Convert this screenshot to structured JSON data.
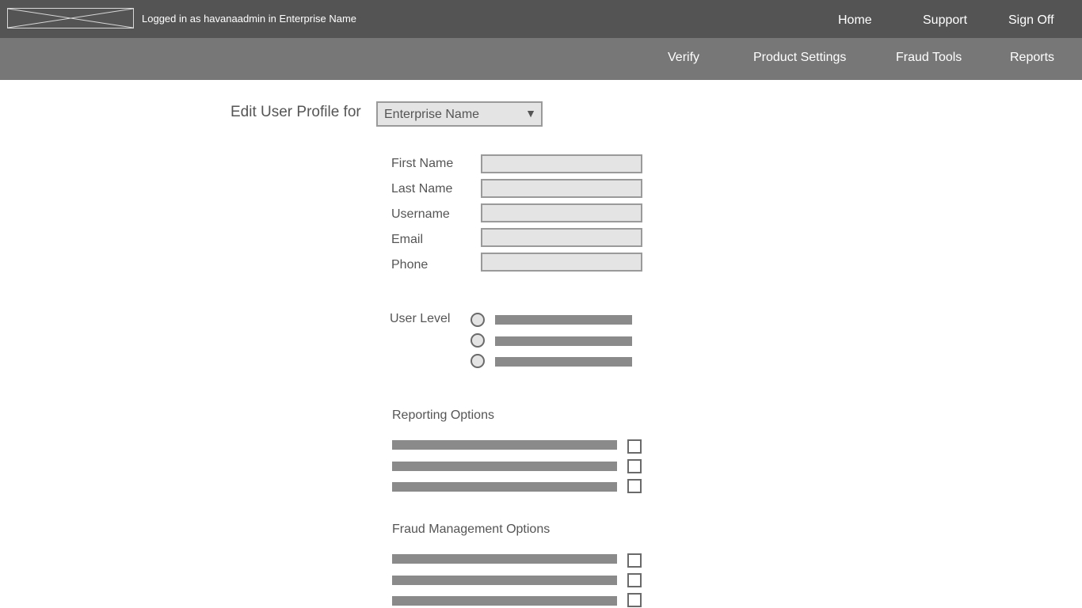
{
  "header": {
    "login_text": "Logged in as havanaadmin in Enterprise Name",
    "nav": [
      "Home",
      "Support",
      "Sign Off"
    ]
  },
  "subnav": [
    "Verify",
    "Product Settings",
    "Fraud Tools",
    "Reports"
  ],
  "form": {
    "title": "Edit User Profile for",
    "enterprise_select": "Enterprise Name",
    "fields": [
      {
        "label": "First Name",
        "value": ""
      },
      {
        "label": "Last Name",
        "value": ""
      },
      {
        "label": "Username",
        "value": ""
      },
      {
        "label": "Email",
        "value": ""
      },
      {
        "label": "Phone",
        "value": ""
      }
    ],
    "user_level_label": "User Level",
    "reporting_heading": "Reporting Options",
    "fraud_heading": "Fraud Management Options"
  },
  "colors": {
    "topbar": "#545454",
    "subbar": "#777777",
    "placeholder_bar": "#8a8a8a",
    "input_fill": "#e4e4e4"
  },
  "icons": {
    "logo": "logo-placeholder-icon",
    "dropdown": "triangle-down-icon"
  }
}
